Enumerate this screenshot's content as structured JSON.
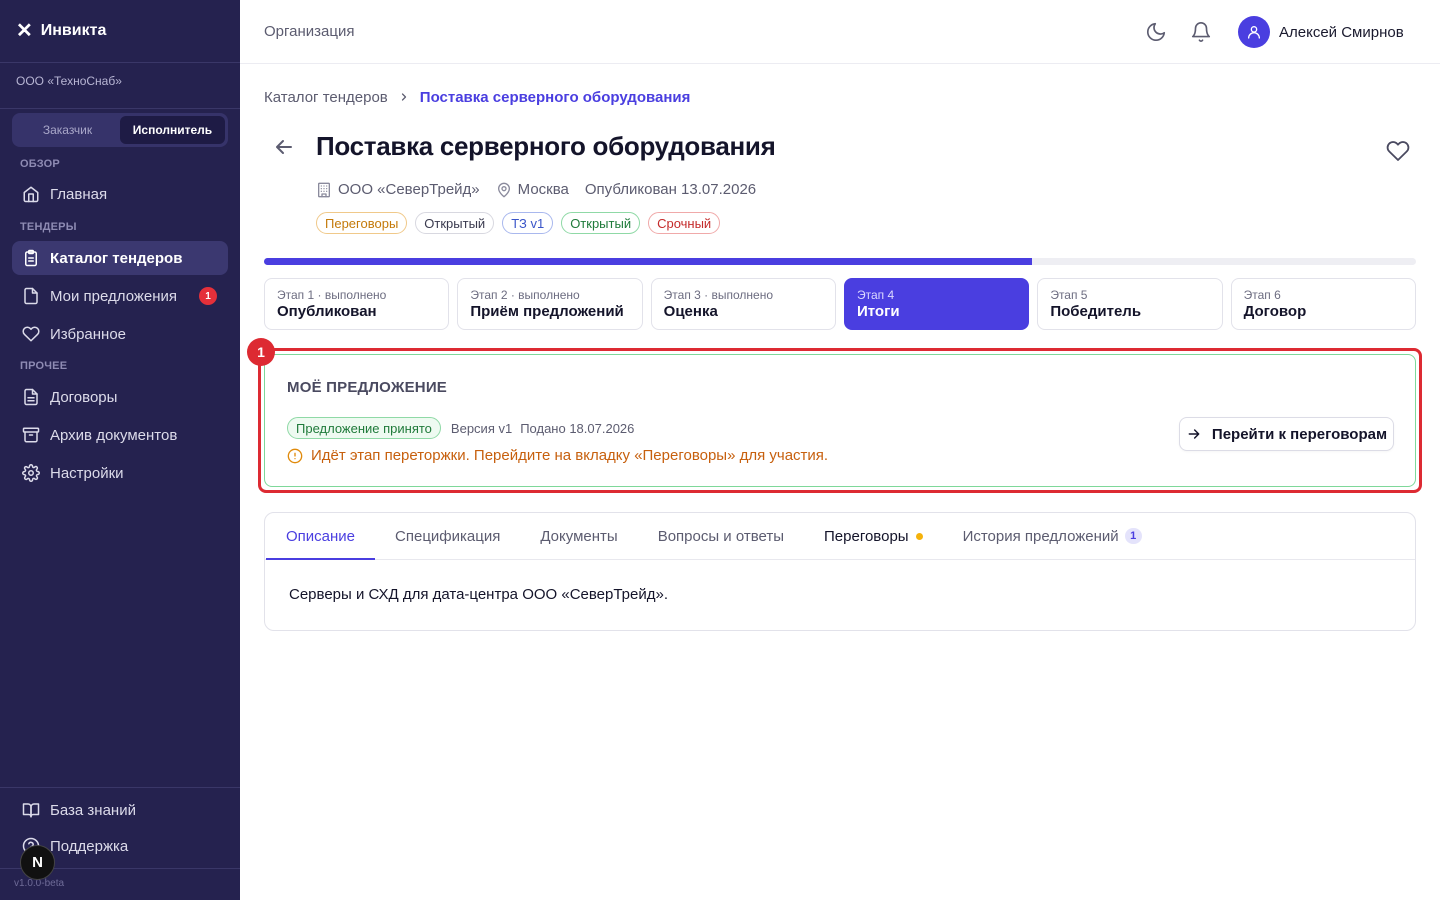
{
  "sidebar": {
    "brand": "Инвикта",
    "org": "ООО «ТехноСнаб»",
    "roles": [
      "Заказчик",
      "Исполнитель"
    ],
    "sections": {
      "overview": "ОБЗОР",
      "tenders": "ТЕНДЕРЫ",
      "other": "ПРОЧЕЕ"
    },
    "items": [
      {
        "label": "Главная",
        "icon": "home-icon"
      },
      {
        "label": "Каталог тендеров",
        "icon": "clipboard-icon",
        "active": true
      },
      {
        "label": "Мои предложения",
        "icon": "file-icon",
        "badge": "1"
      },
      {
        "label": "Избранное",
        "icon": "heart-icon"
      },
      {
        "label": "Договоры",
        "icon": "document-icon"
      },
      {
        "label": "Архив документов",
        "icon": "archive-icon"
      },
      {
        "label": "Настройки",
        "icon": "gear-icon"
      }
    ],
    "bottom": [
      {
        "label": "База знаний",
        "icon": "book-icon"
      },
      {
        "label": "Поддержка",
        "icon": "help-icon"
      }
    ],
    "version": "v1.0.0-beta",
    "n_badge": "N"
  },
  "topbar": {
    "title": "Организация",
    "user_name": "Алексей Смирнов"
  },
  "breadcrumb": {
    "parent": "Каталог тендеров",
    "current": "Поставка серверного оборудования"
  },
  "tender": {
    "title": "Поставка серверного оборудования",
    "company": "ООО «СеверТрейд»",
    "city": "Москва",
    "published": "Опубликован 13.07.2026",
    "tags": [
      {
        "label": "Переговоры",
        "color": "#c47a0a",
        "border": "#f0c98a"
      },
      {
        "label": "Открытый",
        "color": "#3a3a4e",
        "border": "#d8d8e0"
      },
      {
        "label": "ТЗ v1",
        "color": "#3a55c8",
        "border": "#a9b8ee"
      },
      {
        "label": "Открытый",
        "color": "#1f7a3a",
        "border": "#8fd9a6"
      },
      {
        "label": "Срочный",
        "color": "#c42a2a",
        "border": "#f0a9a9"
      }
    ]
  },
  "progress": {
    "fraction": 0.667
  },
  "stages": [
    {
      "sub": "Этап 1 · выполнено",
      "name": "Опубликован"
    },
    {
      "sub": "Этап 2 · выполнено",
      "name": "Приём предложений"
    },
    {
      "sub": "Этап 3 · выполнено",
      "name": "Оценка"
    },
    {
      "sub": "Этап 4",
      "name": "Итоги",
      "active": true
    },
    {
      "sub": "Этап 5",
      "name": "Победитель"
    },
    {
      "sub": "Этап 6",
      "name": "Договор"
    }
  ],
  "highlight_number": "1",
  "offer": {
    "title": "МОЁ ПРЕДЛОЖЕНИЕ",
    "status": "Предложение принято",
    "version": "Версия v1",
    "submitted": "Подано 18.07.2026",
    "warning": "Идёт этап переторжки. Перейдите на вкладку «Переговоры» для участия.",
    "button": "Перейти к переговорам"
  },
  "tabs": [
    {
      "label": "Описание",
      "active": true
    },
    {
      "label": "Спецификация"
    },
    {
      "label": "Документы"
    },
    {
      "label": "Вопросы и ответы"
    },
    {
      "label": "Переговоры",
      "dot": true
    },
    {
      "label": "История предложений",
      "count": "1"
    }
  ],
  "description": "Серверы и СХД для дата-центра ООО «СеверТрейд»."
}
